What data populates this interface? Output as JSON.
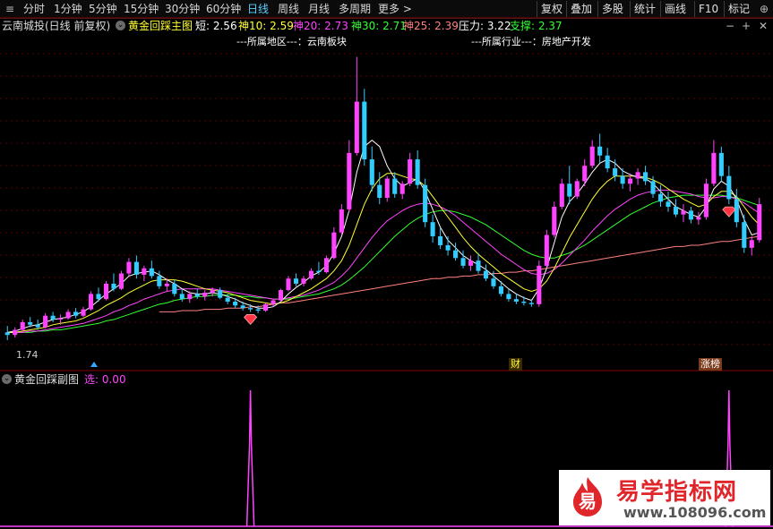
{
  "toolbar": {
    "periods": [
      "分时",
      "1分钟",
      "5分钟",
      "15分钟",
      "30分钟",
      "60分钟",
      "日线",
      "周线",
      "月线",
      "多周期",
      "更多 >"
    ],
    "active_period": "日线",
    "right_buttons": [
      "复权",
      "叠加",
      "多股",
      "统计",
      "画线",
      "F10",
      "标记"
    ]
  },
  "main_info": {
    "stock_name": "云南城投(日线 前复权)",
    "indicator": "黄金回踩主图",
    "items": [
      {
        "label": "短: 2.56",
        "color": "#ffffff"
      },
      {
        "label": "神10: 2.59",
        "color": "#ffff33"
      },
      {
        "label": "神20: 2.73",
        "color": "#ff44ff"
      },
      {
        "label": "神30: 2.71",
        "color": "#33ff33"
      },
      {
        "label": "神25: 2.39",
        "color": "#ff8080"
      },
      {
        "label": "压力: 3.22",
        "color": "#ffffff"
      },
      {
        "label": "支撑: 2.37",
        "color": "#33ff33"
      }
    ]
  },
  "annotations": {
    "region": "---所属地区---：云南板块",
    "industry": "---所属行业---：房地产开发",
    "low_price": "1.74",
    "tag1": "财",
    "tag2": "涨榜"
  },
  "sub_info": {
    "indicator": "黄金回踩副图",
    "value_label": "选: 0.00"
  },
  "watermark": {
    "logo_char": "易",
    "title": "易学指标网",
    "url": "www.108096.com"
  },
  "colors": {
    "up": "#ff44ff",
    "down": "#33ccff",
    "short": "#ffffff",
    "ma10": "#ffff33",
    "ma20": "#ff44ff",
    "ma30": "#33ff33",
    "ma25": "#ff8080"
  },
  "chart_data": {
    "type": "candlestick",
    "y_range": [
      1.6,
      4.1
    ],
    "candles": [
      [
        1.8,
        1.85,
        1.74,
        1.78
      ],
      [
        1.78,
        1.84,
        1.76,
        1.82
      ],
      [
        1.82,
        1.9,
        1.8,
        1.88
      ],
      [
        1.88,
        1.92,
        1.84,
        1.86
      ],
      [
        1.86,
        1.9,
        1.82,
        1.84
      ],
      [
        1.84,
        1.95,
        1.83,
        1.93
      ],
      [
        1.93,
        1.96,
        1.88,
        1.9
      ],
      [
        1.9,
        1.94,
        1.86,
        1.91
      ],
      [
        1.91,
        1.98,
        1.9,
        1.96
      ],
      [
        1.96,
        1.99,
        1.91,
        1.93
      ],
      [
        1.93,
        2.0,
        1.92,
        1.98
      ],
      [
        1.98,
        2.12,
        1.97,
        2.1
      ],
      [
        2.1,
        2.15,
        2.04,
        2.06
      ],
      [
        2.06,
        2.2,
        2.05,
        2.18
      ],
      [
        2.18,
        2.26,
        2.12,
        2.14
      ],
      [
        2.14,
        2.28,
        2.13,
        2.26
      ],
      [
        2.26,
        2.38,
        2.24,
        2.35
      ],
      [
        2.35,
        2.4,
        2.22,
        2.25
      ],
      [
        2.25,
        2.32,
        2.2,
        2.3
      ],
      [
        2.3,
        2.36,
        2.22,
        2.24
      ],
      [
        2.24,
        2.28,
        2.14,
        2.16
      ],
      [
        2.16,
        2.22,
        2.12,
        2.18
      ],
      [
        2.18,
        2.21,
        2.08,
        2.1
      ],
      [
        2.1,
        2.14,
        2.04,
        2.06
      ],
      [
        2.06,
        2.12,
        2.03,
        2.1
      ],
      [
        2.1,
        2.14,
        2.06,
        2.08
      ],
      [
        2.08,
        2.13,
        2.05,
        2.11
      ],
      [
        2.11,
        2.15,
        2.08,
        2.13
      ],
      [
        2.13,
        2.15,
        2.06,
        2.07
      ],
      [
        2.07,
        2.1,
        2.02,
        2.04
      ],
      [
        2.04,
        2.07,
        1.99,
        2.01
      ],
      [
        2.01,
        2.04,
        1.97,
        1.99
      ],
      [
        1.99,
        2.02,
        1.96,
        1.98
      ],
      [
        1.98,
        2.01,
        1.95,
        1.97
      ],
      [
        1.97,
        2.03,
        1.96,
        2.02
      ],
      [
        2.02,
        2.06,
        2.0,
        2.05
      ],
      [
        2.05,
        2.14,
        2.04,
        2.13
      ],
      [
        2.13,
        2.24,
        2.12,
        2.22
      ],
      [
        2.22,
        2.26,
        2.16,
        2.18
      ],
      [
        2.18,
        2.24,
        2.16,
        2.22
      ],
      [
        2.22,
        2.3,
        2.21,
        2.28
      ],
      [
        2.28,
        2.35,
        2.25,
        2.27
      ],
      [
        2.27,
        2.4,
        2.26,
        2.38
      ],
      [
        2.38,
        2.62,
        2.37,
        2.58
      ],
      [
        2.58,
        2.8,
        2.56,
        2.76
      ],
      [
        2.76,
        3.3,
        2.74,
        3.2
      ],
      [
        3.2,
        3.95,
        3.18,
        3.6
      ],
      [
        3.6,
        3.7,
        3.1,
        3.15
      ],
      [
        3.15,
        3.25,
        2.9,
        2.95
      ],
      [
        2.95,
        3.05,
        2.8,
        2.85
      ],
      [
        2.85,
        3.02,
        2.82,
        3.0
      ],
      [
        3.0,
        3.05,
        2.85,
        2.88
      ],
      [
        2.88,
        2.98,
        2.84,
        2.96
      ],
      [
        2.96,
        3.2,
        2.94,
        3.15
      ],
      [
        3.15,
        3.22,
        2.92,
        2.95
      ],
      [
        2.95,
        3.0,
        2.62,
        2.66
      ],
      [
        2.66,
        2.72,
        2.5,
        2.55
      ],
      [
        2.55,
        2.62,
        2.45,
        2.48
      ],
      [
        2.48,
        2.55,
        2.4,
        2.44
      ],
      [
        2.44,
        2.5,
        2.36,
        2.38
      ],
      [
        2.38,
        2.44,
        2.3,
        2.32
      ],
      [
        2.32,
        2.4,
        2.28,
        2.36
      ],
      [
        2.36,
        2.42,
        2.26,
        2.28
      ],
      [
        2.28,
        2.33,
        2.2,
        2.22
      ],
      [
        2.22,
        2.28,
        2.14,
        2.16
      ],
      [
        2.16,
        2.2,
        2.08,
        2.1
      ],
      [
        2.1,
        2.14,
        2.04,
        2.06
      ],
      [
        2.06,
        2.1,
        2.02,
        2.04
      ],
      [
        2.04,
        2.08,
        2.01,
        2.03
      ],
      [
        2.03,
        2.06,
        2.0,
        2.02
      ],
      [
        2.02,
        2.36,
        2.0,
        2.32
      ],
      [
        2.32,
        2.6,
        2.3,
        2.56
      ],
      [
        2.56,
        2.82,
        2.54,
        2.78
      ],
      [
        2.78,
        3.0,
        2.76,
        2.96
      ],
      [
        2.96,
        3.1,
        2.8,
        2.86
      ],
      [
        2.86,
        3.0,
        2.84,
        2.98
      ],
      [
        2.98,
        3.15,
        2.94,
        3.1
      ],
      [
        3.1,
        3.3,
        3.08,
        3.25
      ],
      [
        3.25,
        3.35,
        3.12,
        3.18
      ],
      [
        3.18,
        3.24,
        3.05,
        3.08
      ],
      [
        3.08,
        3.15,
        2.98,
        3.02
      ],
      [
        3.02,
        3.08,
        2.92,
        2.96
      ],
      [
        2.96,
        3.04,
        2.9,
        3.0
      ],
      [
        3.0,
        3.08,
        2.95,
        3.05
      ],
      [
        3.05,
        3.1,
        2.95,
        2.98
      ],
      [
        2.98,
        3.02,
        2.85,
        2.88
      ],
      [
        2.88,
        2.95,
        2.78,
        2.82
      ],
      [
        2.82,
        2.9,
        2.74,
        2.78
      ],
      [
        2.78,
        2.84,
        2.7,
        2.72
      ],
      [
        2.72,
        2.8,
        2.66,
        2.75
      ],
      [
        2.75,
        2.78,
        2.65,
        2.68
      ],
      [
        2.68,
        2.74,
        2.64,
        2.7
      ],
      [
        2.7,
        3.0,
        2.68,
        2.96
      ],
      [
        2.96,
        3.3,
        2.94,
        3.2
      ],
      [
        3.2,
        3.25,
        2.98,
        3.02
      ],
      [
        3.02,
        3.1,
        2.8,
        2.84
      ],
      [
        2.84,
        2.92,
        2.62,
        2.66
      ],
      [
        2.66,
        2.72,
        2.42,
        2.46
      ],
      [
        2.46,
        2.55,
        2.4,
        2.52
      ],
      [
        2.52,
        2.85,
        2.5,
        2.8
      ]
    ],
    "ma_short": [
      1.8,
      1.81,
      1.83,
      1.85,
      1.86,
      1.88,
      1.9,
      1.91,
      1.92,
      1.94,
      1.96,
      2.0,
      2.05,
      2.1,
      2.14,
      2.18,
      2.24,
      2.26,
      2.27,
      2.28,
      2.25,
      2.21,
      2.18,
      2.14,
      2.11,
      2.1,
      2.1,
      2.11,
      2.1,
      2.08,
      2.06,
      2.03,
      2.01,
      1.99,
      1.99,
      2.0,
      2.04,
      2.1,
      2.15,
      2.19,
      2.24,
      2.27,
      2.32,
      2.42,
      2.55,
      2.75,
      3.05,
      3.25,
      3.3,
      3.25,
      3.1,
      3.0,
      2.94,
      2.97,
      3.0,
      2.9,
      2.76,
      2.62,
      2.52,
      2.46,
      2.4,
      2.36,
      2.33,
      2.29,
      2.24,
      2.19,
      2.14,
      2.1,
      2.07,
      2.05,
      2.14,
      2.3,
      2.5,
      2.7,
      2.82,
      2.88,
      2.96,
      3.05,
      3.12,
      3.15,
      3.12,
      3.06,
      3.03,
      3.01,
      3.0,
      2.96,
      2.9,
      2.84,
      2.78,
      2.75,
      2.72,
      2.7,
      2.78,
      2.92,
      2.98,
      2.94,
      2.84,
      2.68,
      2.56,
      2.58
    ],
    "ma10": [
      1.8,
      1.8,
      1.81,
      1.82,
      1.83,
      1.84,
      1.86,
      1.87,
      1.88,
      1.89,
      1.91,
      1.94,
      1.97,
      2.01,
      2.04,
      2.07,
      2.11,
      2.14,
      2.17,
      2.2,
      2.21,
      2.21,
      2.21,
      2.2,
      2.18,
      2.16,
      2.14,
      2.13,
      2.12,
      2.11,
      2.09,
      2.07,
      2.05,
      2.04,
      2.03,
      2.02,
      2.03,
      2.05,
      2.08,
      2.11,
      2.14,
      2.18,
      2.22,
      2.28,
      2.36,
      2.48,
      2.64,
      2.8,
      2.92,
      3.0,
      3.04,
      3.04,
      3.02,
      3.0,
      2.99,
      2.94,
      2.86,
      2.78,
      2.7,
      2.62,
      2.54,
      2.47,
      2.41,
      2.36,
      2.31,
      2.26,
      2.22,
      2.18,
      2.14,
      2.12,
      2.14,
      2.2,
      2.3,
      2.42,
      2.54,
      2.64,
      2.74,
      2.84,
      2.92,
      2.98,
      3.02,
      3.02,
      3.02,
      3.02,
      3.01,
      2.99,
      2.96,
      2.92,
      2.88,
      2.84,
      2.81,
      2.78,
      2.8,
      2.86,
      2.9,
      2.9,
      2.86,
      2.78,
      2.7,
      2.64
    ],
    "ma20": [
      1.8,
      1.8,
      1.8,
      1.81,
      1.81,
      1.82,
      1.83,
      1.84,
      1.85,
      1.86,
      1.87,
      1.89,
      1.91,
      1.93,
      1.96,
      1.98,
      2.01,
      2.03,
      2.06,
      2.08,
      2.1,
      2.12,
      2.13,
      2.14,
      2.14,
      2.14,
      2.14,
      2.14,
      2.13,
      2.12,
      2.11,
      2.1,
      2.09,
      2.08,
      2.07,
      2.06,
      2.06,
      2.07,
      2.08,
      2.09,
      2.11,
      2.13,
      2.16,
      2.19,
      2.24,
      2.3,
      2.38,
      2.46,
      2.54,
      2.61,
      2.67,
      2.71,
      2.75,
      2.78,
      2.8,
      2.81,
      2.8,
      2.78,
      2.75,
      2.71,
      2.66,
      2.61,
      2.56,
      2.51,
      2.46,
      2.41,
      2.37,
      2.33,
      2.29,
      2.26,
      2.25,
      2.26,
      2.29,
      2.34,
      2.4,
      2.46,
      2.52,
      2.59,
      2.65,
      2.71,
      2.76,
      2.8,
      2.84,
      2.87,
      2.89,
      2.9,
      2.91,
      2.91,
      2.9,
      2.89,
      2.88,
      2.86,
      2.85,
      2.85,
      2.86,
      2.86,
      2.84,
      2.81,
      2.77,
      2.73
    ],
    "ma30": [
      1.8,
      1.8,
      1.8,
      1.8,
      1.81,
      1.81,
      1.82,
      1.82,
      1.83,
      1.84,
      1.85,
      1.86,
      1.87,
      1.89,
      1.9,
      1.92,
      1.94,
      1.96,
      1.98,
      2.0,
      2.02,
      2.03,
      2.05,
      2.06,
      2.07,
      2.08,
      2.08,
      2.09,
      2.09,
      2.09,
      2.09,
      2.08,
      2.08,
      2.07,
      2.07,
      2.06,
      2.06,
      2.06,
      2.07,
      2.08,
      2.09,
      2.1,
      2.12,
      2.14,
      2.17,
      2.21,
      2.26,
      2.31,
      2.37,
      2.43,
      2.49,
      2.55,
      2.6,
      2.65,
      2.69,
      2.72,
      2.74,
      2.75,
      2.75,
      2.74,
      2.72,
      2.7,
      2.67,
      2.64,
      2.6,
      2.56,
      2.52,
      2.48,
      2.44,
      2.41,
      2.39,
      2.38,
      2.38,
      2.4,
      2.42,
      2.45,
      2.48,
      2.52,
      2.56,
      2.6,
      2.64,
      2.68,
      2.72,
      2.75,
      2.78,
      2.81,
      2.83,
      2.85,
      2.86,
      2.87,
      2.87,
      2.87,
      2.87,
      2.87,
      2.87,
      2.86,
      2.85,
      2.83,
      2.81,
      2.79
    ],
    "ma25": [
      null,
      null,
      null,
      null,
      null,
      null,
      null,
      null,
      null,
      null,
      null,
      null,
      null,
      null,
      null,
      null,
      null,
      null,
      null,
      null,
      1.96,
      1.96,
      1.96,
      1.97,
      1.97,
      1.97,
      1.98,
      1.98,
      1.98,
      1.99,
      1.99,
      1.99,
      2.0,
      2.0,
      2.01,
      2.02,
      2.03,
      2.03,
      2.04,
      2.05,
      2.06,
      2.07,
      2.08,
      2.09,
      2.1,
      2.11,
      2.12,
      2.13,
      2.14,
      2.15,
      2.16,
      2.17,
      2.18,
      2.19,
      2.2,
      2.21,
      2.22,
      2.22,
      2.23,
      2.23,
      2.24,
      2.24,
      2.25,
      2.25,
      2.26,
      2.26,
      2.27,
      2.27,
      2.28,
      2.28,
      2.29,
      2.3,
      2.31,
      2.32,
      2.33,
      2.34,
      2.35,
      2.36,
      2.37,
      2.38,
      2.39,
      2.4,
      2.41,
      2.42,
      2.43,
      2.44,
      2.45,
      2.46,
      2.47,
      2.47,
      2.48,
      2.48,
      2.49,
      2.5,
      2.51,
      2.51,
      2.52,
      2.53,
      2.54,
      2.55
    ],
    "diamond_markers": [
      32,
      95
    ],
    "sub_spikes": [
      32,
      95
    ]
  }
}
